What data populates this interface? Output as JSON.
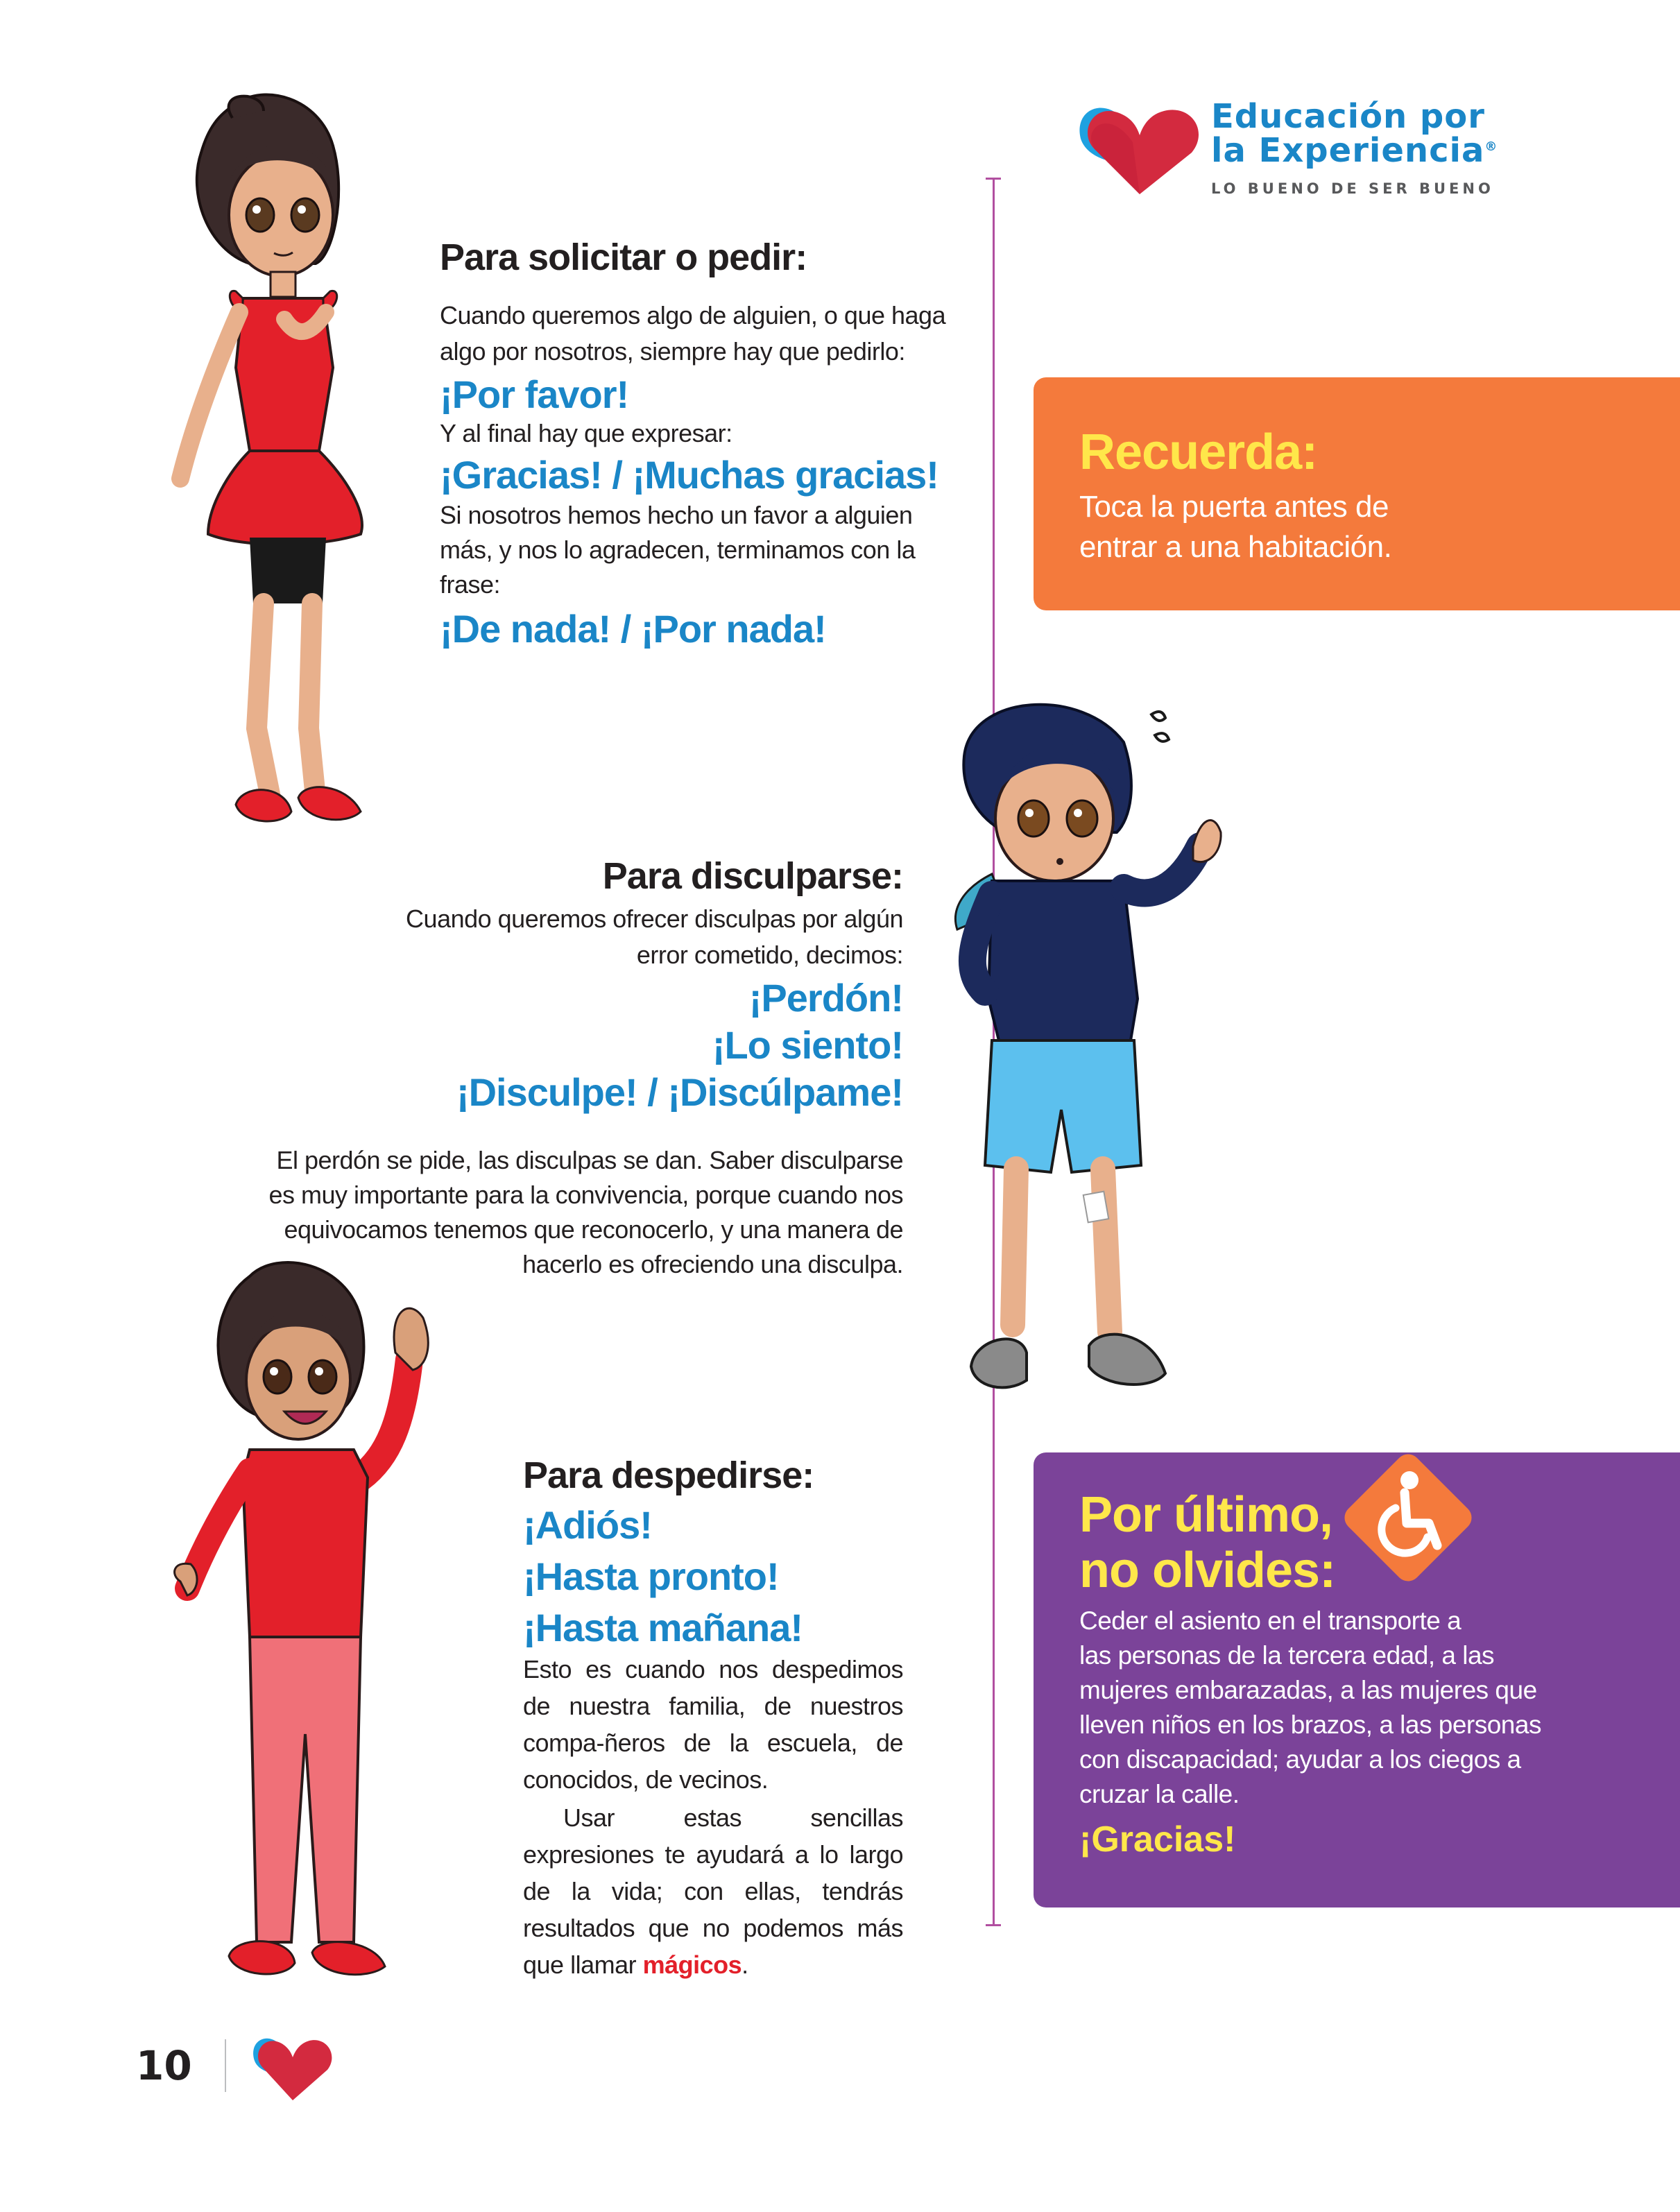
{
  "header": {
    "logo_line1": "Educación por",
    "logo_line2": "la Experiencia",
    "logo_reg": "®",
    "tagline": "LO BUENO DE SER BUENO"
  },
  "section_request": {
    "title": "Para solicitar o pedir:",
    "intro_line1": "Cuando queremos algo de alguien, o que haga",
    "intro_line2": "algo por nosotros, siempre hay que pedirlo:",
    "expression1": "¡Por favor!",
    "line_final": "Y al final hay que expresar:",
    "expression2": "¡Gracias! / ¡Muchas gracias!",
    "favor_line1": "Si nosotros hemos hecho un favor a alguien",
    "favor_line2": "más, y nos lo agradecen, terminamos con la",
    "favor_line3": "frase:",
    "expression3": "¡De nada! / ¡Por nada!"
  },
  "section_apology": {
    "title": "Para disculparse:",
    "intro_line1": "Cuando queremos ofrecer disculpas por algún",
    "intro_line2": "error cometido, decimos:",
    "expression1": "¡Perdón!",
    "expression2": "¡Lo siento!",
    "expression3": "¡Disculpe! / ¡Discúlpame!",
    "para_line1": "El perdón se pide, las disculpas se dan. Saber disculparse",
    "para_line2": "es muy importante para la convivencia, porque cuando nos",
    "para_line3": "equivocamos tenemos que reconocerlo, y una manera de",
    "para_line4": "hacerlo es ofreciendo una disculpa."
  },
  "section_farewell": {
    "title": "Para despedirse:",
    "expression1": "¡Adiós!",
    "expression2": "¡Hasta pronto!",
    "expression3": "¡Hasta mañana!",
    "para1": "Esto es cuando nos despedimos de nuestra familia, de nuestros compa-ñeros de la escuela, de conocidos, de vecinos.",
    "para2_start": "Usar estas sencillas expresiones te ayudará a lo largo de la vida; con ellas, tendrás resultados que no podemos más que llamar ",
    "para2_highlight": "mágicos",
    "para2_end": "."
  },
  "box_remember": {
    "title": "Recuerda:",
    "line1": "Toca la puerta antes de",
    "line2": "entrar a una habitación.",
    "color": "#f47a3c"
  },
  "box_finally": {
    "title_line1": "Por último,",
    "title_line2": "no olvides:",
    "line1": "Ceder el asiento en el transporte a",
    "line2": "las personas de la tercera edad, a las",
    "line3": "mujeres embarazadas, a las mujeres que",
    "line4": "lleven niños en los brazos, a las personas",
    "line5": "con discapacidad; ayudar a los ciegos a",
    "line6": "cruzar la calle.",
    "closing": "¡Gracias!",
    "icon": "wheelchair-icon",
    "color": "#7b4399"
  },
  "footer": {
    "page_number": "10"
  },
  "colors": {
    "blue": "#1a86c7",
    "red": "#e3202a",
    "yellow": "#ffe74a",
    "orange": "#f47a3c",
    "purple": "#7b4399"
  }
}
